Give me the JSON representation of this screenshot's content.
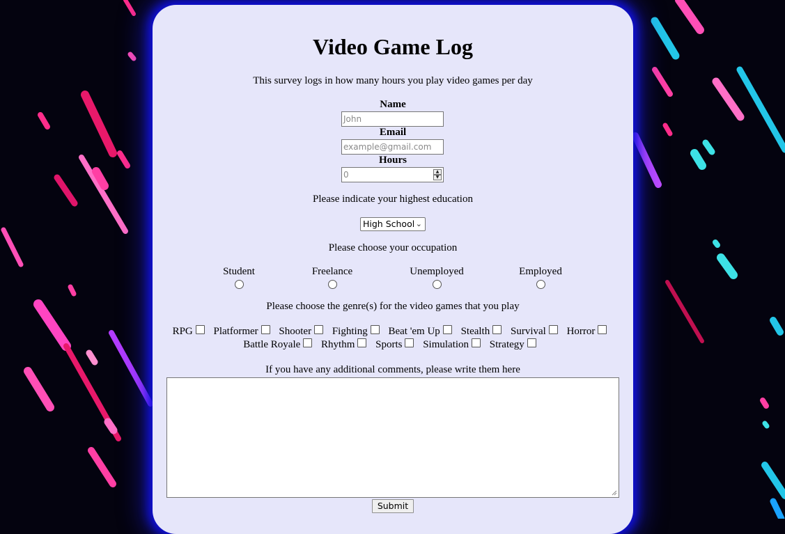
{
  "page": {
    "title": "Video Game Log",
    "description": "This survey logs in how many hours you play video games per day"
  },
  "fields": {
    "name": {
      "label": "Name",
      "placeholder": "John"
    },
    "email": {
      "label": "Email",
      "placeholder": "example@gmail.com"
    },
    "hours": {
      "label": "Hours",
      "placeholder": "0"
    }
  },
  "education": {
    "prompt": "Please indicate your highest education",
    "selected": "High School"
  },
  "occupation": {
    "prompt": "Please choose your occupation",
    "options": [
      "Student",
      "Freelance",
      "Unemployed",
      "Employed"
    ]
  },
  "genres": {
    "prompt": "Please choose the genre(s) for the video games that you play",
    "options": [
      "RPG",
      "Platformer",
      "Shooter",
      "Fighting",
      "Beat 'em Up",
      "Stealth",
      "Survival",
      "Horror",
      "Battle Royale",
      "Rhythm",
      "Sports",
      "Simulation",
      "Strategy"
    ]
  },
  "comments": {
    "prompt": "If you have any additional comments, please write them here"
  },
  "submit_label": "Submit",
  "colors": {
    "card_background": "#e6e6fa",
    "glow": "#1010e0",
    "page_background": "#04030f",
    "streak_pink": "#ff3fa4",
    "streak_cyan": "#23c6e8",
    "streak_purple": "#b23cff"
  },
  "icons": {
    "spin_up": "spin-up-icon",
    "spin_down": "spin-down-icon",
    "select_arrow": "chevron-down-icon",
    "resize": "resize-grip-icon"
  }
}
